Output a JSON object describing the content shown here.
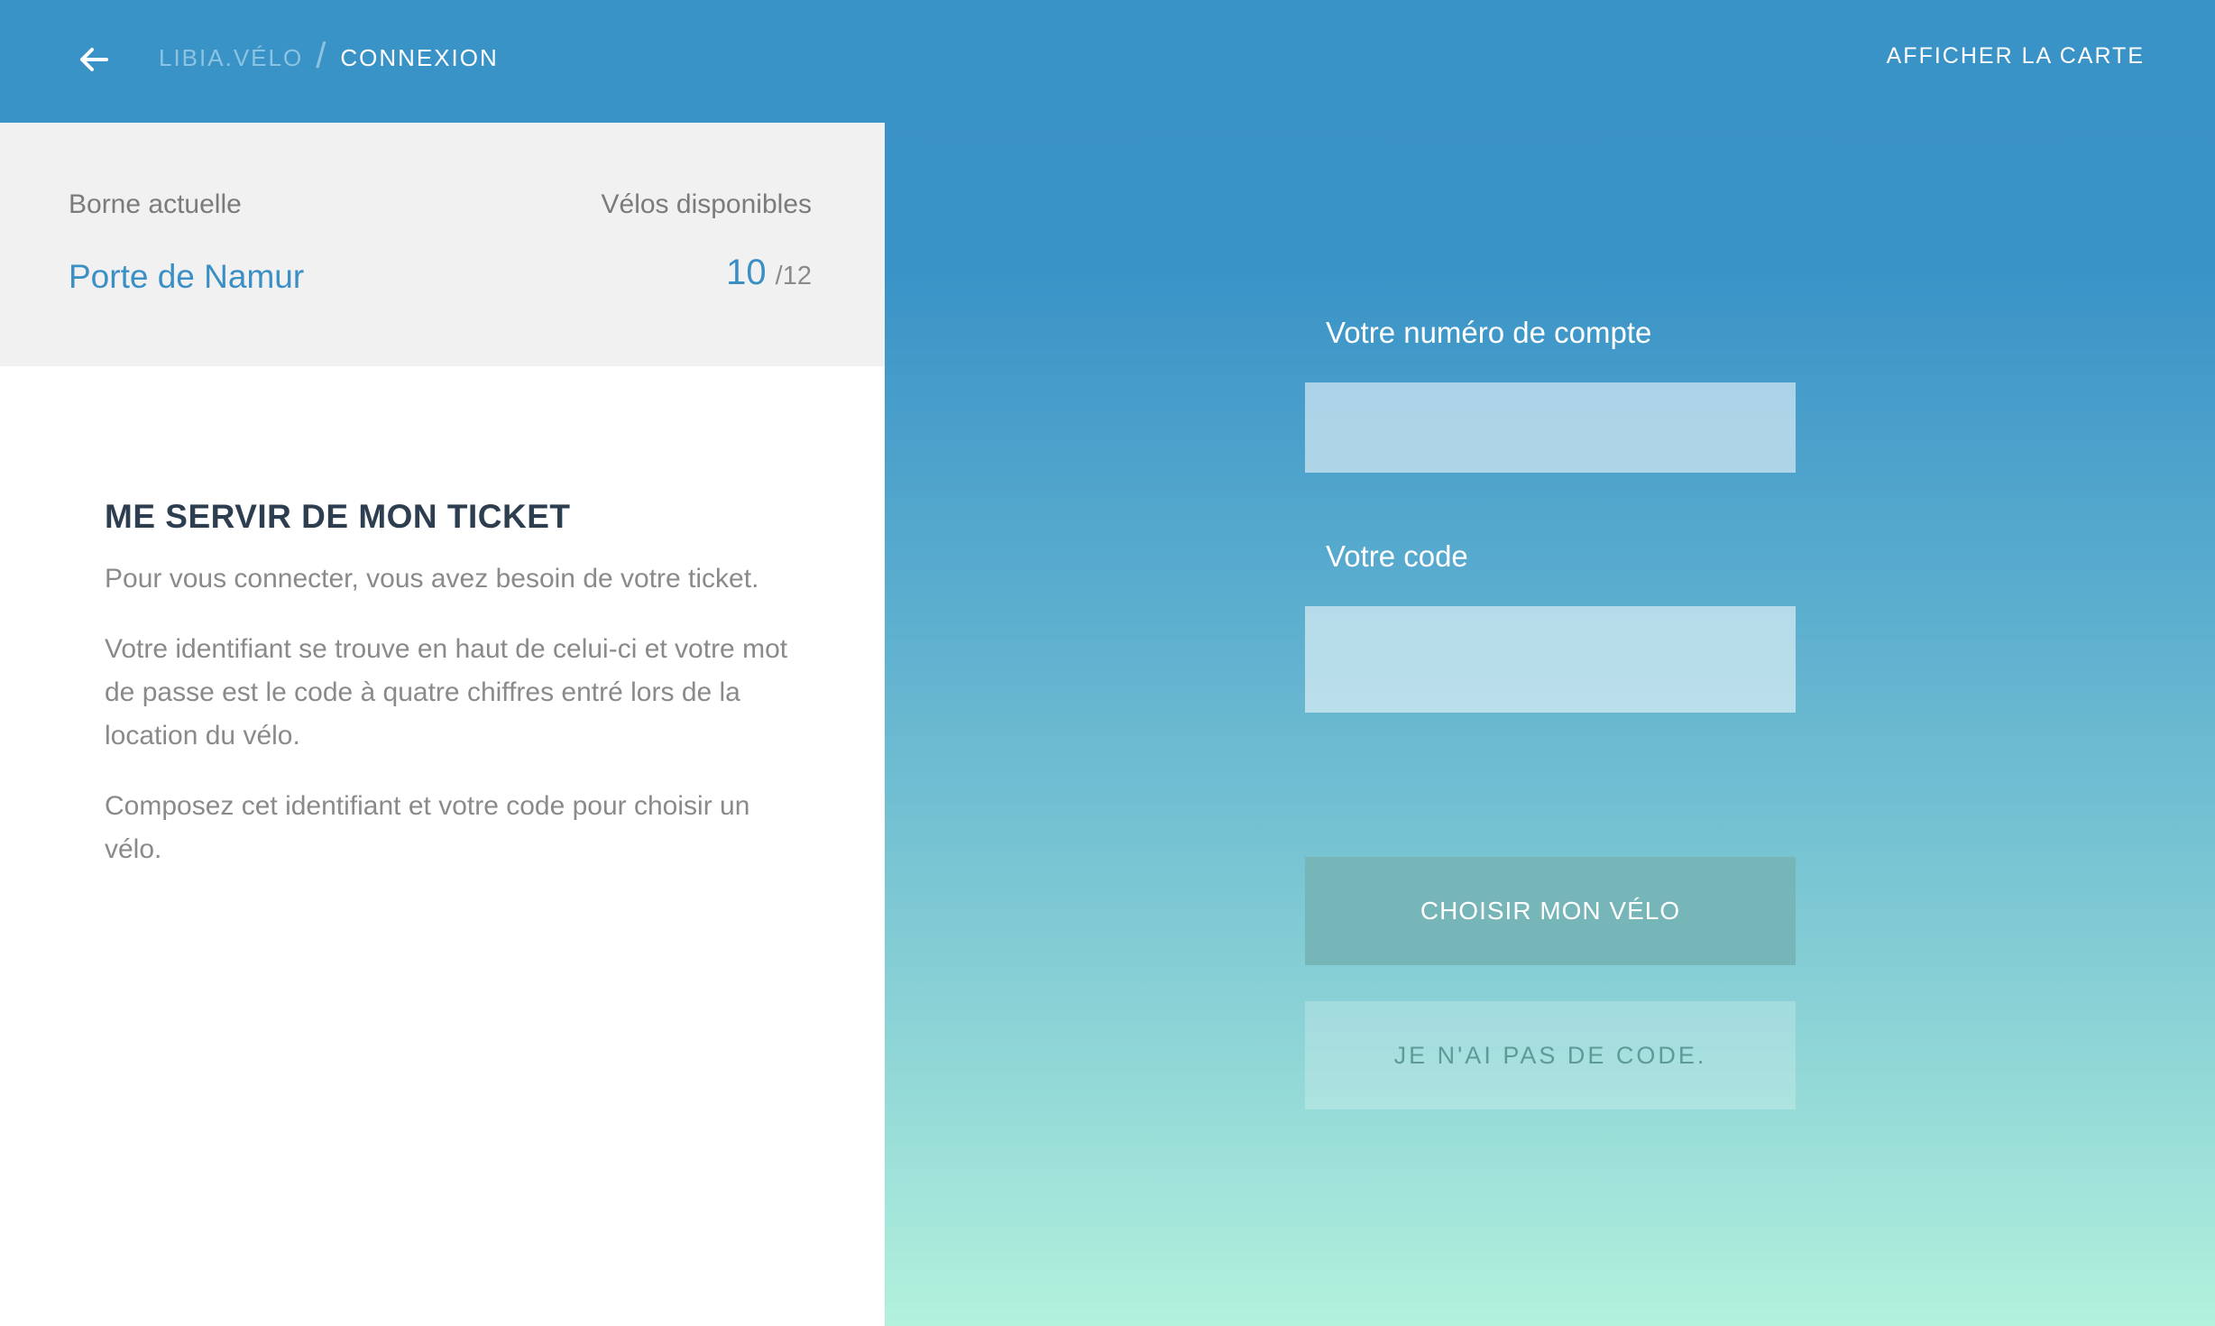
{
  "header": {
    "breadcrumb_root": "LIBIA.VÉLO",
    "breadcrumb_separator": "/",
    "breadcrumb_current": "CONNEXION",
    "map_link": "AFFICHER LA CARTE",
    "back_icon": "arrow-left-icon"
  },
  "station": {
    "station_label": "Borne actuelle",
    "station_name": "Porte de Namur",
    "bikes_label": "Vélos disponibles",
    "bikes_available": "10",
    "bikes_total": "/12"
  },
  "instructions": {
    "title": "ME SERVIR DE MON TICKET",
    "paragraphs": [
      "Pour vous connecter, vous avez besoin de votre ticket.",
      "Votre identifiant se trouve en haut de celui-ci et votre mot de passe est le code à quatre chiffres entré lors de la location du vélo.",
      "Composez cet identifiant et votre code pour choisir un vélo."
    ]
  },
  "form": {
    "account_label": "Votre numéro de compte",
    "account_value": "",
    "code_label": "Votre code",
    "code_value": "",
    "submit_label": "CHOISIR MON VÉLO",
    "no_code_label": "JE N'AI PAS DE CODE."
  },
  "colors": {
    "accent": "#3a93c7",
    "gradient_bottom": "#b2f1dc",
    "station_name": "#3a8fc5"
  }
}
